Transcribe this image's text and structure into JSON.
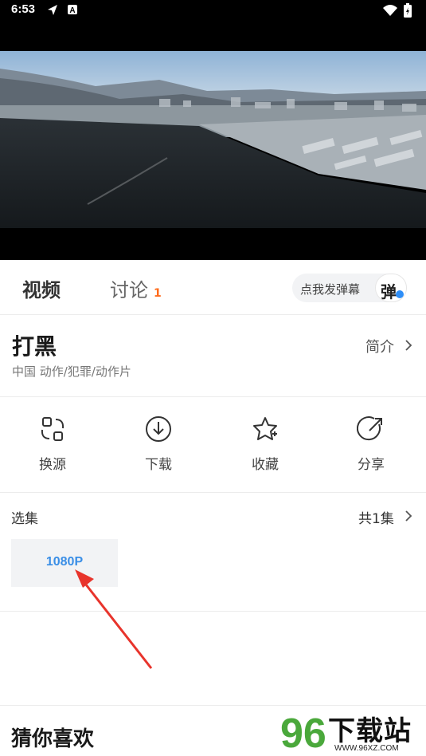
{
  "status_bar": {
    "time": "6:53"
  },
  "tabs": {
    "video_label": "视频",
    "discuss_label": "讨论",
    "discuss_count": "1"
  },
  "danmu": {
    "placeholder": "点我发弹幕",
    "button_char": "弹"
  },
  "movie": {
    "title": "打黑",
    "meta": "中国 动作/犯罪/动作片",
    "intro_label": "简介"
  },
  "actions": [
    {
      "label": "换源",
      "icon": "switch-source-icon"
    },
    {
      "label": "下载",
      "icon": "download-icon"
    },
    {
      "label": "收藏",
      "icon": "favorite-star-icon"
    },
    {
      "label": "分享",
      "icon": "share-icon"
    }
  ],
  "episodes": {
    "title": "选集",
    "total": "共1集",
    "items": [
      "1080P"
    ]
  },
  "recommend": {
    "title": "猜你喜欢"
  },
  "watermark": {
    "logo_text": "96",
    "site_text": "下载站",
    "url": "WWW.96XZ.COM"
  },
  "colors": {
    "accent": "#3a8ee6",
    "badge": "#ff6a1a",
    "arrow": "#e8342c"
  }
}
